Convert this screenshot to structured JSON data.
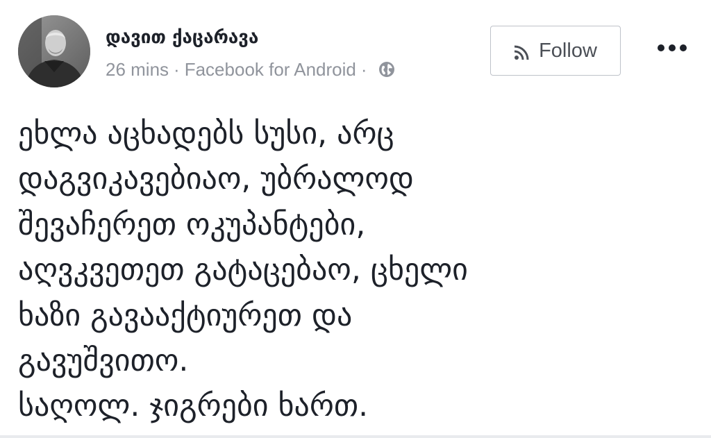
{
  "author": {
    "name": "დავით ქაცარავა",
    "avatar_icon": "profile-photo"
  },
  "meta": {
    "time": "26 mins",
    "separator": "·",
    "source": "Facebook for Android",
    "privacy_icon": "globe-icon"
  },
  "actions": {
    "follow_label": "Follow",
    "follow_icon": "rss-icon",
    "more_icon": "more-dots-icon"
  },
  "post": {
    "lines": [
      "ეხლა აცხადებს სუსი, არც",
      "დაგვიკავებიაო, უბრალოდ",
      "შევაჩერეთ ოკუპანტები,",
      "აღვკვეთეთ გატაცებაო, ცხელი",
      "ხაზი გავააქტიურეთ და",
      "გავუშვითო.",
      "საღოლ. ჯიგრები ხართ."
    ]
  },
  "colors": {
    "text": "#1d2129",
    "meta": "#90949c",
    "button_border": "#bec2c9",
    "button_text": "#4b4f56"
  }
}
